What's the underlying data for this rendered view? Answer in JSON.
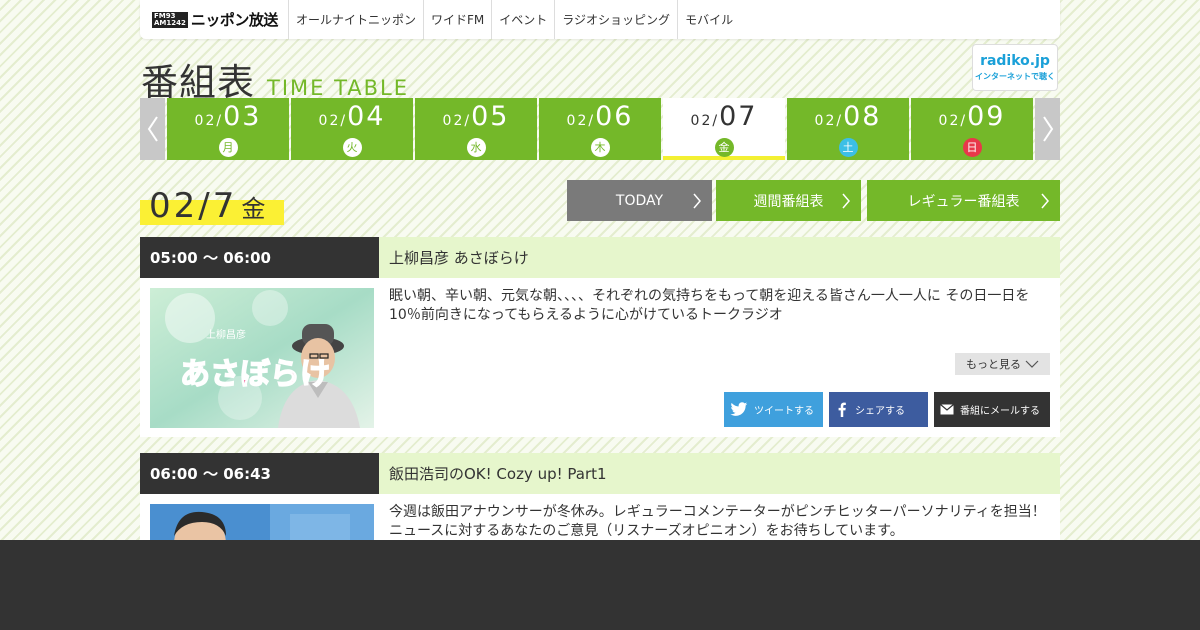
{
  "header": {
    "logo_badge_top": "FM93",
    "logo_badge_bottom": "AM1242",
    "logo_text": "ニッポン放送",
    "nav": [
      "オールナイトニッポン",
      "ワイドFM",
      "イベント",
      "ラジオショッピング",
      "モバイル"
    ]
  },
  "title": {
    "jp": "番組表",
    "en": "TIME TABLE"
  },
  "radiko": {
    "name": "radiko.jp",
    "sub": "インターネットで聴く"
  },
  "dates": [
    {
      "month": "02/",
      "day": "03",
      "weekday": "月"
    },
    {
      "month": "02/",
      "day": "04",
      "weekday": "火"
    },
    {
      "month": "02/",
      "day": "05",
      "weekday": "水"
    },
    {
      "month": "02/",
      "day": "06",
      "weekday": "木"
    },
    {
      "month": "02/",
      "day": "07",
      "weekday": "金"
    },
    {
      "month": "02/",
      "day": "08",
      "weekday": "土"
    },
    {
      "month": "02/",
      "day": "09",
      "weekday": "日"
    }
  ],
  "selected_date": {
    "date": "02/7",
    "weekday": "金"
  },
  "buttons": {
    "today": "TODAY",
    "weekly": "週間番組表",
    "regular": "レギュラー番組表"
  },
  "programs": [
    {
      "time": "05:00 ～ 06:00",
      "title": "上柳昌彦 あさぼらけ",
      "description": "眠い朝、辛い朝、元気な朝、、、、それぞれの気持ちをもって朝を迎える皆さん一人一人に その日一日を10％前向きになってもらえるように心がけているトークラジオ",
      "thumb_text": "あさぼらけ",
      "thumb_sub": "上柳昌彦",
      "more": "もっと見る",
      "tweet": "ツイートする",
      "share": "シェアする",
      "mail": "番組にメールする"
    },
    {
      "time": "06:00 ～ 06:43",
      "title": "飯田浩司のOK! Cozy up! Part1",
      "description": "今週は飯田アナウンサーが冬休み。レギュラーコメンテーターがピンチヒッターパーソナリティを担当！ニュースに対するあなたのご意見（リスナーズオピニオン）をお待ちしています。"
    }
  ],
  "colors": {
    "green": "#74b829",
    "yellow": "#fbf034",
    "dark": "#333333",
    "title_bg": "#e6f6cc"
  }
}
